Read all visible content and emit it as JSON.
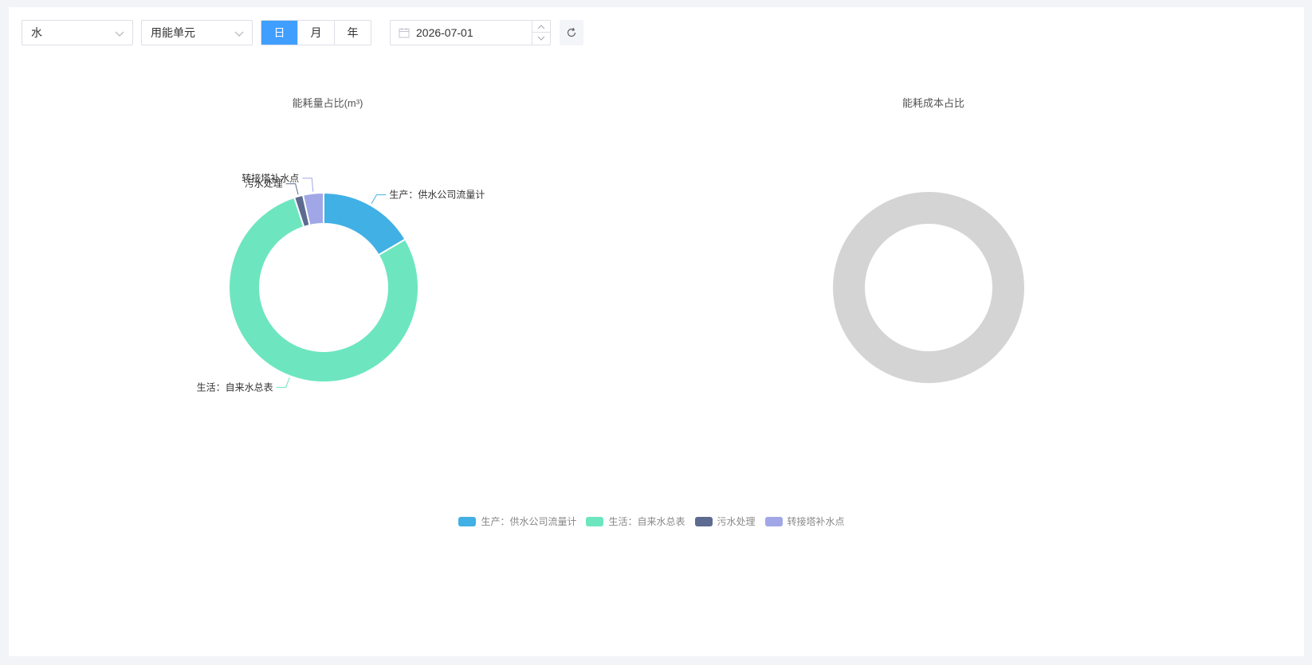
{
  "toolbar": {
    "energy_select": "水",
    "unit_select": "用能单元",
    "period_buttons": [
      {
        "label": "日",
        "active": true
      },
      {
        "label": "月",
        "active": false
      },
      {
        "label": "年",
        "active": false
      }
    ],
    "date_value": "2026-07-01"
  },
  "colors": {
    "accent": "#409eff",
    "empty_ring": "#d4d4d4"
  },
  "chart_data": [
    {
      "type": "pie",
      "variant": "donut",
      "title": "能耗量占比(m³)",
      "slices": [
        {
          "name": "生产：供水公司流量计",
          "value": 16.5,
          "color": "#41b0e4"
        },
        {
          "name": "生活：自来水总表",
          "value": 78.5,
          "color": "#6de6c0"
        },
        {
          "name": "污水处理",
          "value": 1.5,
          "color": "#5d6b90"
        },
        {
          "name": "转接塔补水点",
          "value": 3.5,
          "color": "#a1a7e6"
        }
      ]
    },
    {
      "type": "pie",
      "variant": "donut",
      "title": "能耗成本占比",
      "slices": []
    }
  ],
  "legend": [
    {
      "name": "生产：供水公司流量计",
      "color": "#41b0e4"
    },
    {
      "name": "生活：自来水总表",
      "color": "#6de6c0"
    },
    {
      "name": "污水处理",
      "color": "#5d6b90"
    },
    {
      "name": "转接塔补水点",
      "color": "#a1a7e6"
    }
  ]
}
